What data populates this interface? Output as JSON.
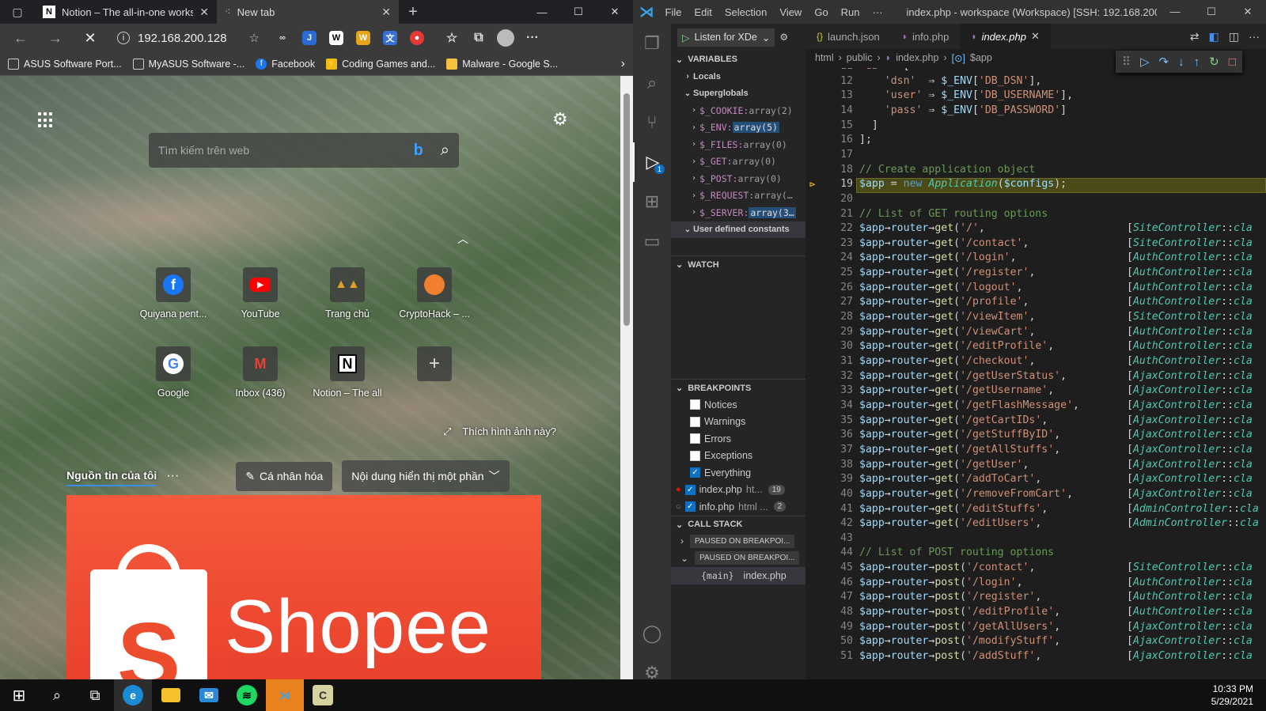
{
  "browser": {
    "tabs": [
      {
        "label": "Notion – The all-in-one workspa"
      },
      {
        "label": "New tab"
      }
    ],
    "address": "192.168.200.128",
    "bookmarks": [
      "ASUS Software Port...",
      "MyASUS Software -...",
      "Facebook",
      "Coding Games and...",
      "Malware - Google S..."
    ],
    "search_placeholder": "Tìm kiếm trên web",
    "tiles": [
      "Quiyana pent...",
      "YouTube",
      "Trang chủ",
      "CryptoHack – ...",
      "Google",
      "Inbox (436)",
      "Notion – The all"
    ],
    "like_image": "Thích hình ảnh này?",
    "feed": {
      "title": "Nguồn tin của tôi",
      "personalize": "Cá nhân hóa",
      "display": "Nội dung hiển thị một phần"
    },
    "ad": {
      "word": "Shopee",
      "letter": "S"
    }
  },
  "vscode": {
    "menu": [
      "File",
      "Edit",
      "Selection",
      "View",
      "Go",
      "Run",
      "···"
    ],
    "title": "index.php - workspace (Workspace) [SSH: 192.168.200.128]...",
    "debug_config": "Listen for XDe",
    "sections": {
      "variables": "VARIABLES",
      "watch": "WATCH",
      "breakpoints": "BREAKPOINTS",
      "callstack": "CALL STACK"
    },
    "variables": {
      "locals": "Locals",
      "superglobals": "Superglobals",
      "user_constants": "User defined constants",
      "items": [
        [
          "$_COOKIE:",
          "array(2)"
        ],
        [
          "$_ENV:",
          "array(5)"
        ],
        [
          "$_FILES:",
          "array(0)"
        ],
        [
          "$_GET:",
          "array(0)"
        ],
        [
          "$_POST:",
          "array(0)"
        ],
        [
          "$_REQUEST:",
          "array(…"
        ],
        [
          "$_SERVER:",
          "array(3…"
        ]
      ]
    },
    "breakpoints": {
      "options": [
        {
          "label": "Notices",
          "checked": false
        },
        {
          "label": "Warnings",
          "checked": false
        },
        {
          "label": "Errors",
          "checked": false
        },
        {
          "label": "Exceptions",
          "checked": false
        },
        {
          "label": "Everything",
          "checked": true
        }
      ],
      "files": [
        {
          "name": "index.php",
          "path": "ht...",
          "line": "19"
        },
        {
          "name": "info.php",
          "path": "html ...",
          "line": "2"
        }
      ]
    },
    "callstack": {
      "threads": [
        "PAUSED ON BREAKPOI...",
        "PAUSED ON BREAKPOI..."
      ],
      "frame_fn": "{main}",
      "frame_file": "index.php"
    },
    "tabs": [
      "launch.json",
      "info.php",
      "index.php"
    ],
    "breadcrumb": [
      "html",
      "public",
      "index.php",
      "$app"
    ],
    "colors": {
      "current_line": "#4b4b18",
      "accent": "#0e70c0"
    }
  },
  "taskbar": {
    "time": "10:33 PM",
    "date": "5/29/2021"
  }
}
